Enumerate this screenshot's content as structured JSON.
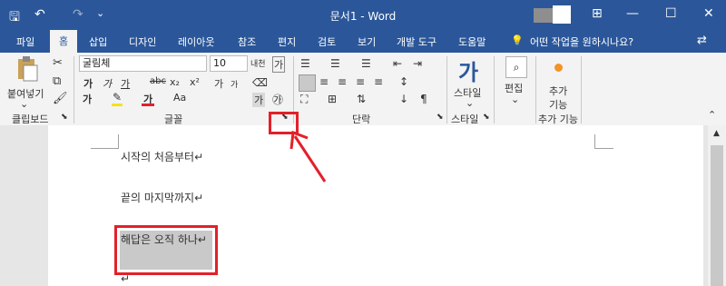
{
  "titlebar": {
    "title": "문서1  -  Word",
    "undo_glyph": "↶",
    "redo_glyph": "↷",
    "save_glyph": "🖫",
    "customize_glyph": "⌄",
    "ribbon_display_glyph": "⊞",
    "minimize_glyph": "—",
    "maximize_glyph": "☐",
    "close_glyph": "✕"
  },
  "tabs": [
    "파일",
    "홈",
    "삽입",
    "디자인",
    "레이아웃",
    "참조",
    "편지",
    "검토",
    "보기",
    "개발 도구",
    "도움말"
  ],
  "tell_me": {
    "glyph": "💡",
    "text": "어떤 작업을 원하시나요?"
  },
  "share_glyph": "⇄",
  "ribbon": {
    "clipboard": {
      "paste_label": "붙여넣기",
      "group_label": "클립보드"
    },
    "font": {
      "font_name": "굴림체",
      "font_size": "10",
      "group_label": "글꼴",
      "row2": [
        "가",
        "가",
        "가",
        "abc",
        "x₂",
        "x²"
      ],
      "row3": [
        "가",
        "가",
        "Aa"
      ],
      "extra": [
        "가",
        "가",
        "가",
        "㉮",
        "내천"
      ]
    },
    "paragraph": {
      "group_label": "단락"
    },
    "styles": {
      "style_label": "스타일",
      "group_label": "스타일"
    },
    "editing": {
      "edit_label": "편집"
    },
    "addins": {
      "label_line1": "추가",
      "label_line2": "기능",
      "group_label": "추가 기능"
    }
  },
  "document": {
    "lines": [
      "시작의 처음부터↵",
      "끝의 마지막까지↵",
      "해답은 오직 하나↵",
      "↵"
    ]
  },
  "colors": {
    "accent": "#2b579a",
    "highlight": "#e3202a"
  }
}
